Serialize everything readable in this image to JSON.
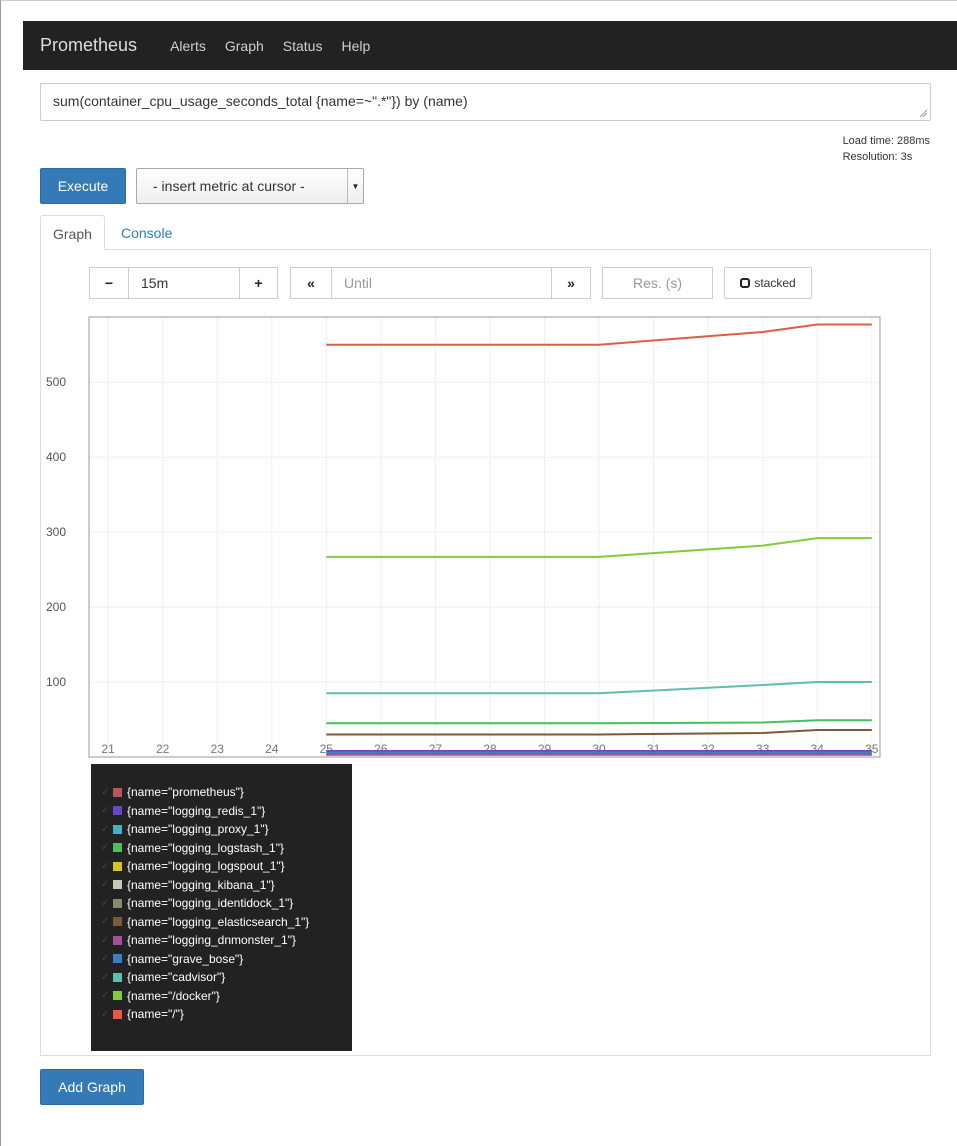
{
  "nav": {
    "brand": "Prometheus",
    "items": [
      "Alerts",
      "Graph",
      "Status",
      "Help"
    ]
  },
  "expression": {
    "value": "sum(container_cpu_usage_seconds_total {name=~\".*\"}) by (name)"
  },
  "stats": {
    "load_time": "Load time: 288ms",
    "resolution": "Resolution: 3s"
  },
  "execute_label": "Execute",
  "metric_select": "- insert metric at cursor -",
  "tabs": {
    "graph": "Graph",
    "console": "Console"
  },
  "controls": {
    "minus": "−",
    "range": "15m",
    "plus": "+",
    "back": "«",
    "until_placeholder": "Until",
    "forward": "»",
    "res_placeholder": "Res. (s)",
    "stacked_label": "stacked"
  },
  "chart_data": {
    "type": "line",
    "x_ticks": [
      "21",
      "22",
      "23",
      "24",
      "25",
      "26",
      "27",
      "28",
      "29",
      "30",
      "31",
      "32",
      "33",
      "34",
      "35"
    ],
    "x_range": [
      20.65,
      35.15
    ],
    "y_ticks": [
      "100",
      "200",
      "300",
      "400",
      "500"
    ],
    "ylim": [
      0,
      587
    ],
    "grid": true,
    "series": [
      {
        "name": "{name=\"/\"}",
        "color": "#e05d44",
        "x": [
          25,
          30,
          33,
          34,
          35
        ],
        "y": [
          550,
          550,
          567,
          577,
          577
        ]
      },
      {
        "name": "{name=\"/docker\"}",
        "color": "#7fcd3a",
        "x": [
          25,
          30,
          33,
          34,
          35
        ],
        "y": [
          267,
          267,
          282,
          292,
          292
        ]
      },
      {
        "name": "{name=\"cadvisor\"}",
        "color": "#5cbfb0",
        "x": [
          25,
          30,
          33,
          34,
          35
        ],
        "y": [
          85,
          85,
          96,
          100,
          100
        ]
      },
      {
        "name": "{name=\"logging_logstash_1\"}",
        "color": "#44c15a",
        "x": [
          25,
          30,
          33,
          34,
          35
        ],
        "y": [
          45,
          45,
          46,
          49,
          49
        ]
      },
      {
        "name": "{name=\"logging_elasticsearch_1\"}",
        "color": "#7a5a3a",
        "x": [
          25,
          30,
          33,
          34,
          35
        ],
        "y": [
          30,
          30,
          32,
          36,
          36
        ]
      },
      {
        "name": "{name=\"logging_redis_1\"}",
        "color": "#6a47c2",
        "x": [
          25,
          35
        ],
        "y": [
          8,
          8
        ]
      },
      {
        "name": "{name=\"prometheus\"}",
        "color": "#b35b5b",
        "x": [
          25,
          35
        ],
        "y": [
          4,
          4
        ]
      },
      {
        "name": "{name=\"grave_bose\"}",
        "color": "#3a7fc4",
        "x": [
          25,
          35
        ],
        "y": [
          6,
          6
        ]
      },
      {
        "name": "{name=\"logging_dnmonster_1\"}",
        "color": "#a34f9a",
        "x": [
          25,
          35
        ],
        "y": [
          3,
          3
        ]
      }
    ]
  },
  "legend": [
    {
      "label": "{name=\"prometheus\"}",
      "color": "#b35b5b"
    },
    {
      "label": "{name=\"logging_redis_1\"}",
      "color": "#6a47c2"
    },
    {
      "label": "{name=\"logging_proxy_1\"}",
      "color": "#47b1c2"
    },
    {
      "label": "{name=\"logging_logstash_1\"}",
      "color": "#44c15a"
    },
    {
      "label": "{name=\"logging_logspout_1\"}",
      "color": "#d8c22a"
    },
    {
      "label": "{name=\"logging_kibana_1\"}",
      "color": "#c8c8b8"
    },
    {
      "label": "{name=\"logging_identidock_1\"}",
      "color": "#8a8a72"
    },
    {
      "label": "{name=\"logging_elasticsearch_1\"}",
      "color": "#7a5a3a"
    },
    {
      "label": "{name=\"logging_dnmonster_1\"}",
      "color": "#a34f9a"
    },
    {
      "label": "{name=\"grave_bose\"}",
      "color": "#3a7fc4"
    },
    {
      "label": "{name=\"cadvisor\"}",
      "color": "#5cbfb0"
    },
    {
      "label": "{name=\"/docker\"}",
      "color": "#7fcd3a"
    },
    {
      "label": "{name=\"/\"}",
      "color": "#e05d44"
    }
  ],
  "add_graph_label": "Add Graph"
}
